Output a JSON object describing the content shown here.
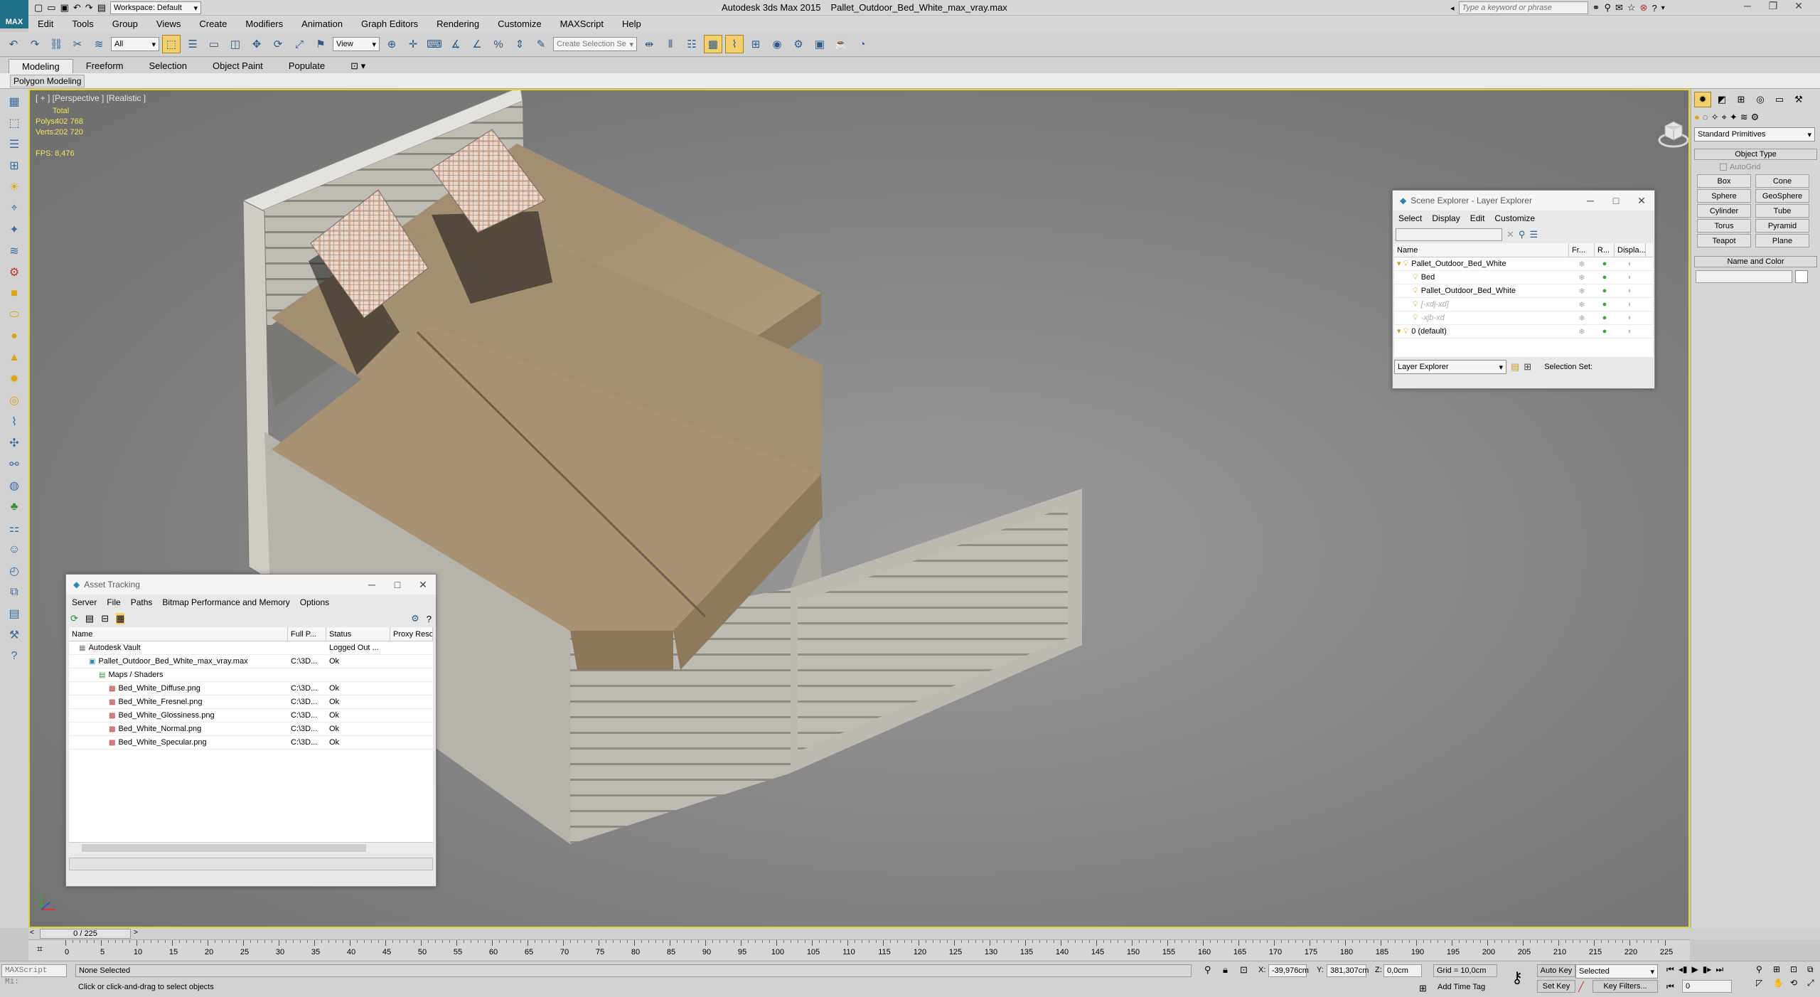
{
  "app": {
    "title": "Autodesk 3ds Max  2015",
    "file": "Pallet_Outdoor_Bed_White_max_vray.max",
    "logo": "MAX",
    "workspace": "Workspace: Default",
    "search_placeholder": "Type a keyword or phrase"
  },
  "menu": [
    "Edit",
    "Tools",
    "Group",
    "Views",
    "Create",
    "Modifiers",
    "Animation",
    "Graph Editors",
    "Rendering",
    "Customize",
    "MAXScript",
    "Help"
  ],
  "toolbar": {
    "filter": "All",
    "coord": "View",
    "selection_set": "Create Selection Se"
  },
  "ribbon": {
    "tabs": [
      "Modeling",
      "Freeform",
      "Selection",
      "Object Paint",
      "Populate"
    ],
    "active_tab": "Modeling",
    "sub_tab": "Polygon Modeling"
  },
  "viewport": {
    "label": "[ + ] [Perspective ] [Realistic ]",
    "stats": {
      "total_label": "Total",
      "polys_label": "Polys:",
      "polys": "402 768",
      "verts_label": "Verts:",
      "verts": "202 720",
      "fps_label": "FPS:",
      "fps": "8,476"
    }
  },
  "command_panel": {
    "category": "Standard Primitives",
    "object_type_head": "Object Type",
    "autogrid": "AutoGrid",
    "buttons": [
      "Box",
      "Cone",
      "Sphere",
      "GeoSphere",
      "Cylinder",
      "Tube",
      "Torus",
      "Pyramid",
      "Teapot",
      "Plane"
    ],
    "name_color_head": "Name and Color"
  },
  "scene_explorer": {
    "title": "Scene Explorer - Layer Explorer",
    "menu": [
      "Select",
      "Display",
      "Edit",
      "Customize"
    ],
    "columns": [
      "Name",
      "Fr...",
      "R...",
      "Displa..."
    ],
    "rows": [
      {
        "name": "Pallet_Outdoor_Bed_White",
        "indent": 0
      },
      {
        "name": "Bed",
        "indent": 1
      },
      {
        "name": "Pallet_Outdoor_Bed_White",
        "indent": 1
      },
      {
        "name": "[-xdj-xd]",
        "indent": 1
      },
      {
        "name": "-xjb-xd",
        "indent": 1
      },
      {
        "name": "0 (default)",
        "indent": 0
      }
    ],
    "footer_select": "Layer Explorer",
    "selection_set_label": "Selection Set:"
  },
  "asset_tracking": {
    "title": "Asset Tracking",
    "menu": [
      "Server",
      "File",
      "Paths",
      "Bitmap Performance and Memory",
      "Options"
    ],
    "columns": [
      "Name",
      "Full P...",
      "Status",
      "Proxy Reso"
    ],
    "rows": [
      {
        "name": "Autodesk Vault",
        "path": "",
        "status": "Logged Out ...",
        "indent": 1
      },
      {
        "name": "Pallet_Outdoor_Bed_White_max_vray.max",
        "path": "C:\\3D...",
        "status": "Ok",
        "indent": 2
      },
      {
        "name": "Maps / Shaders",
        "path": "",
        "status": "",
        "indent": 3
      },
      {
        "name": "Bed_White_Diffuse.png",
        "path": "C:\\3D...",
        "status": "Ok",
        "indent": 4
      },
      {
        "name": "Bed_White_Fresnel.png",
        "path": "C:\\3D...",
        "status": "Ok",
        "indent": 4
      },
      {
        "name": "Bed_White_Glossiness.png",
        "path": "C:\\3D...",
        "status": "Ok",
        "indent": 4
      },
      {
        "name": "Bed_White_Normal.png",
        "path": "C:\\3D...",
        "status": "Ok",
        "indent": 4
      },
      {
        "name": "Bed_White_Specular.png",
        "path": "C:\\3D...",
        "status": "Ok",
        "indent": 4
      }
    ]
  },
  "timeline": {
    "frame_counter": "0 / 225",
    "ticks": [
      0,
      5,
      10,
      15,
      20,
      25,
      30,
      35,
      40,
      45,
      50,
      55,
      60,
      65,
      70,
      75,
      80,
      85,
      90,
      95,
      100,
      105,
      110,
      115,
      120,
      125,
      130,
      135,
      140,
      145,
      150,
      155,
      160,
      165,
      170,
      175,
      180,
      185,
      190,
      195,
      200,
      205,
      210,
      215,
      220,
      225
    ]
  },
  "status": {
    "maxscript": "MAXScript Mi:",
    "selection": "None Selected",
    "prompt": "Click or click-and-drag to select objects",
    "x_label": "X:",
    "x": "-39,976cm",
    "y_label": "Y:",
    "y": "381,307cm",
    "z_label": "Z:",
    "z": "0,0cm",
    "grid": "Grid = 10,0cm",
    "add_time_tag": "Add Time Tag",
    "auto_key": "Auto Key",
    "set_key": "Set Key",
    "key_mode": "Selected",
    "key_filters": "Key Filters...",
    "frame": "0"
  },
  "colors": {
    "viewport_border": "#e3d236",
    "stat_text": "#f2e45a",
    "cushion": "#a48f71",
    "pallet": "#c9c6bf"
  }
}
